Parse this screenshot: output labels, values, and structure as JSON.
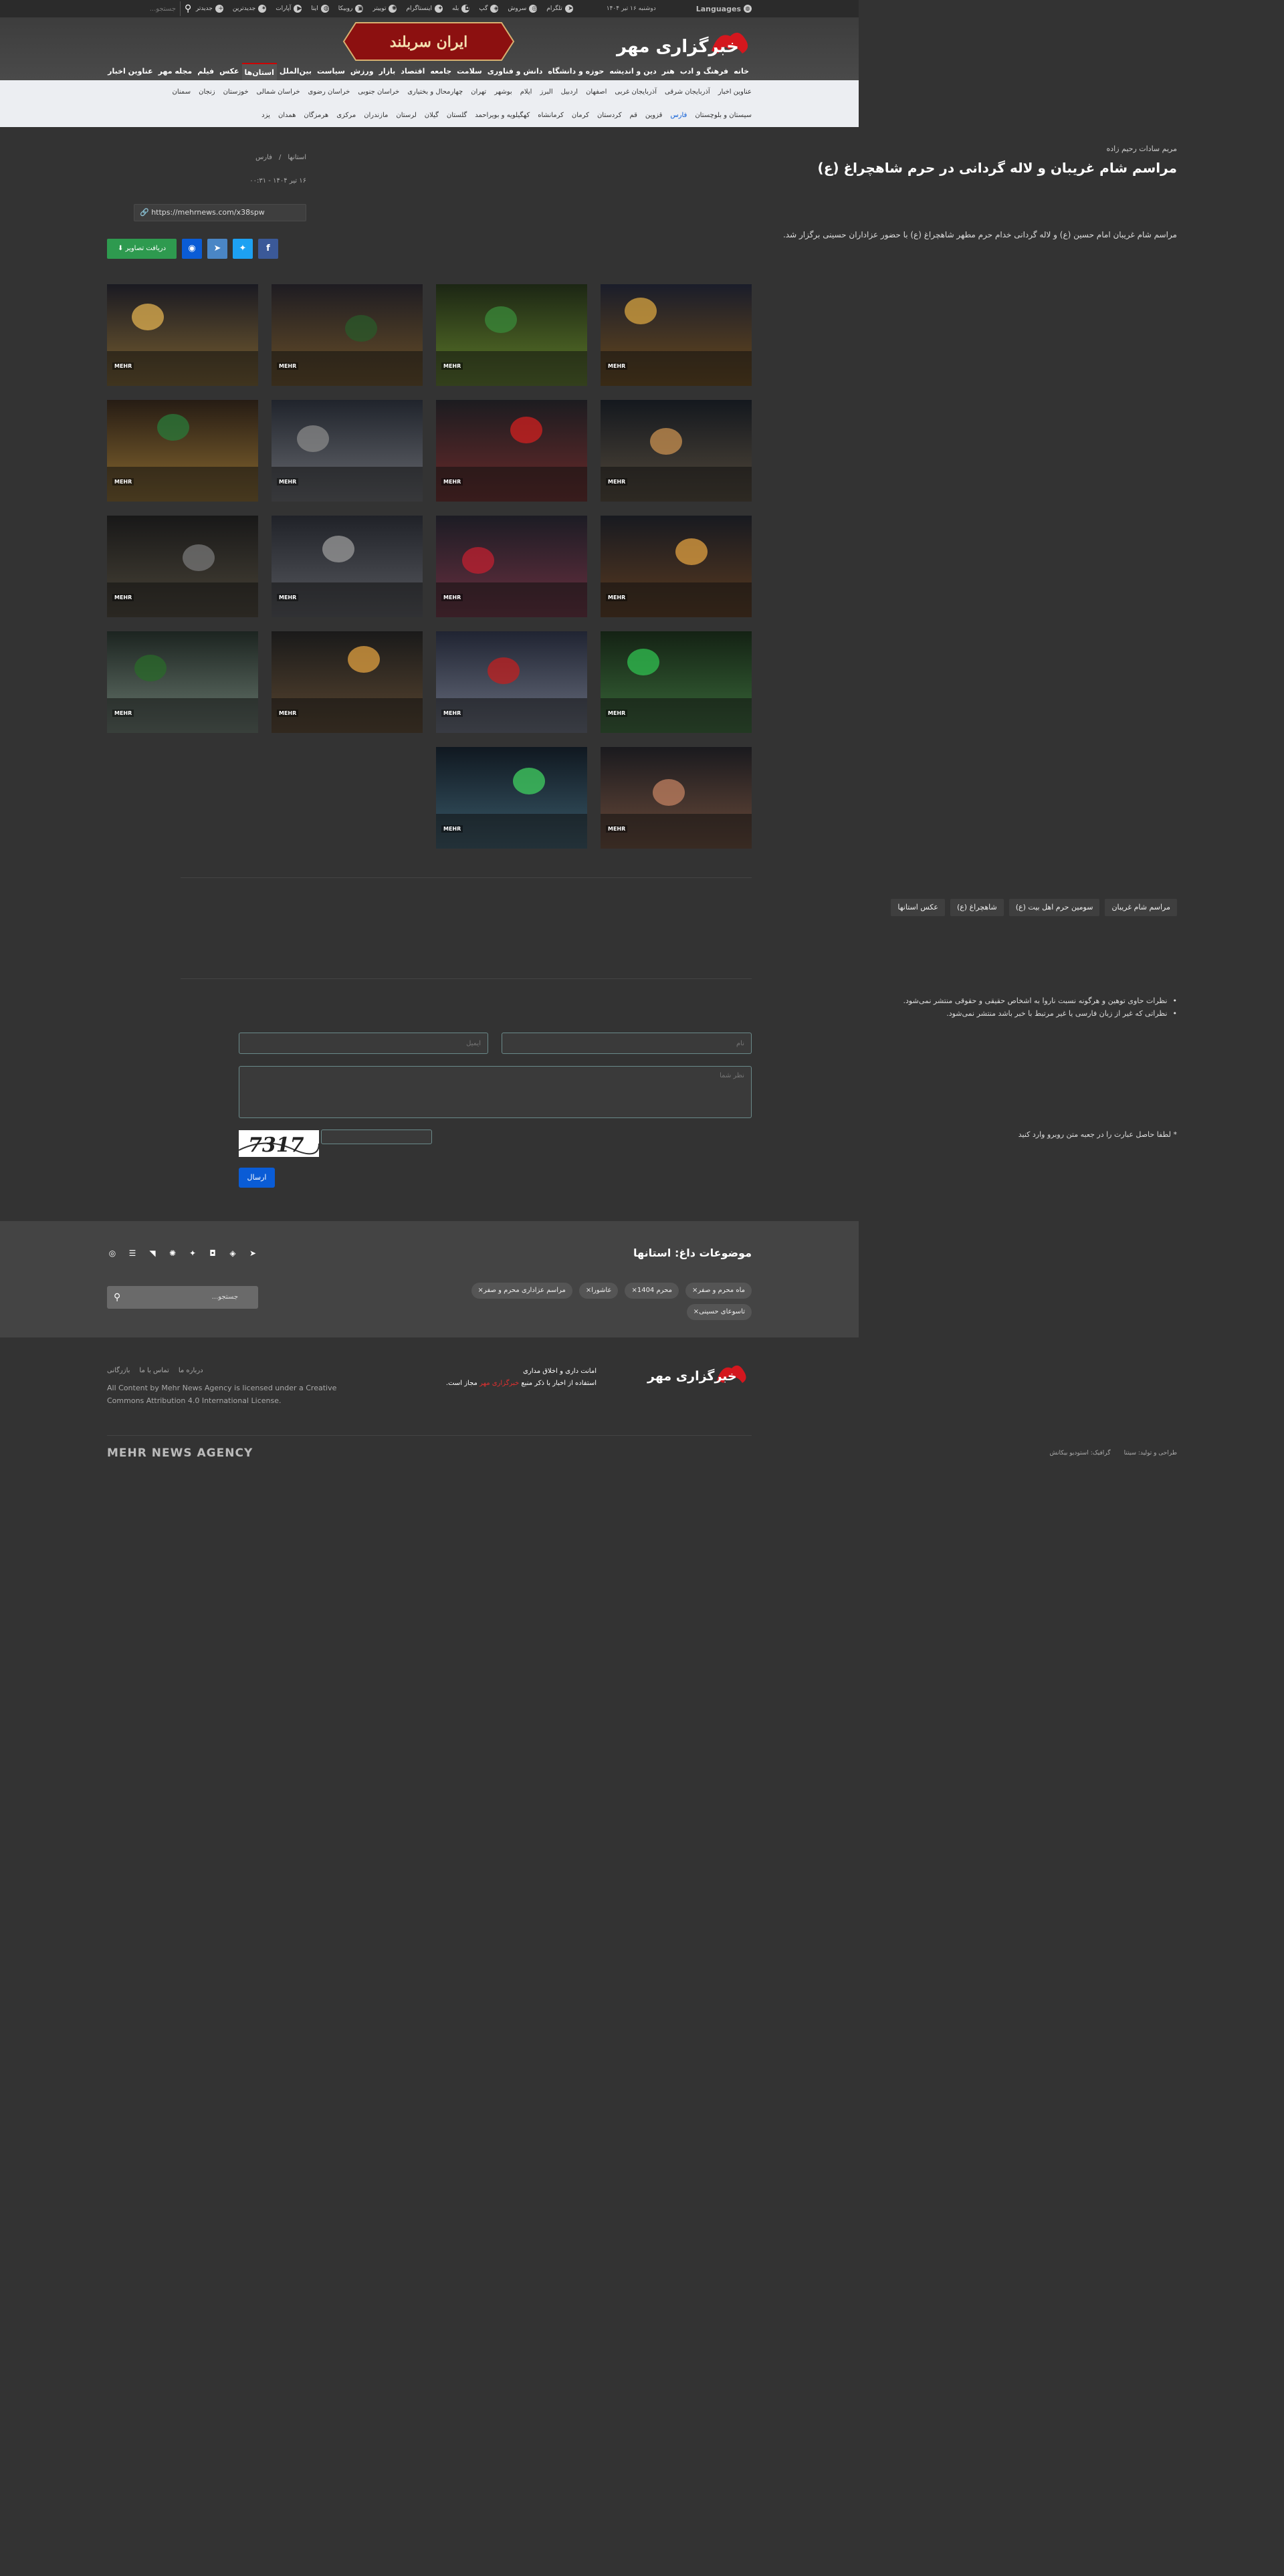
{
  "topbar": {
    "languages": "Languages",
    "date": "دوشنبه ۱۶ تیر ۱۴۰۴",
    "social": [
      "تلگرام",
      "سروش",
      "گپ",
      "بله",
      "اینستاگرام",
      "توییتر",
      "روبیکا",
      "ایتا",
      "آپارات",
      "جدیدترین"
    ],
    "tag_search": "جدیدتر",
    "search_placeholder": "جستجو..."
  },
  "banner_text": "ایران سربلند",
  "logo_text": "خبرگزاری مهر",
  "main_nav": [
    "خانه",
    "فرهنگ و ادب",
    "هنر",
    "دین و اندیشه",
    "حوزه و دانشگاه",
    "دانش و فناوری",
    "سلامت",
    "جامعه",
    "اقتصاد",
    "بازار",
    "ورزش",
    "سیاست",
    "بین‌الملل",
    "استان‌ها",
    "عکس",
    "فیلم",
    "مجله مهر",
    "عناوین اخبار"
  ],
  "main_nav_active": 13,
  "sub_nav_row1": [
    "عناوین اخبار",
    "آذربایجان شرقی",
    "آذربایجان غربی",
    "اصفهان",
    "اردبیل",
    "البرز",
    "ایلام",
    "بوشهر",
    "تهران",
    "چهارمحال و بختیاری",
    "خراسان جنوبی",
    "خراسان رضوی",
    "خراسان شمالی",
    "خوزستان",
    "زنجان",
    "سمنان"
  ],
  "sub_nav_row2": [
    "سیستان و بلوچستان",
    "فارس",
    "قزوین",
    "قم",
    "کردستان",
    "کرمان",
    "کرمانشاه",
    "کهگیلویه و بویراحمد",
    "گلستان",
    "گیلان",
    "لرستان",
    "مازندران",
    "مرکزی",
    "هرمزگان",
    "همدان",
    "یزد"
  ],
  "sub_nav_highlight": 1,
  "article": {
    "author": "مریم سادات رحیم زاده",
    "title": "مراسم شام غریبان و لاله گردانی در حرم شاهچراغ (ع)",
    "breadcrumb": [
      "استانها",
      "فارس"
    ],
    "datetime": "۱۶ تیر ۱۴۰۴ - ۰۰:۳۱",
    "shortlink": "https://mehrnews.com/x38spw",
    "lead": "مراسم شام غریبان امام حسین (ع) و لاله گردانی خدام حرم مطهر شاهچراغ (ع) با حضور عزاداران حسینی برگزار شد.",
    "download_label": "دریافت تصاویر",
    "photo_logo": "MEHR"
  },
  "photos": [
    {
      "c1": "#1a1d2a",
      "c2": "#6b4a1c",
      "accent": "#d8a440"
    },
    {
      "c1": "#1c2614",
      "c2": "#5e7a2a",
      "accent": "#3a8a3a"
    },
    {
      "c1": "#1e1c22",
      "c2": "#6a5028",
      "accent": "#2a5a2a"
    },
    {
      "c1": "#1a1a22",
      "c2": "#7a6030",
      "accent": "#e0b050"
    },
    {
      "c1": "#14181e",
      "c2": "#52483a",
      "accent": "#c89050"
    },
    {
      "c1": "#1c1c20",
      "c2": "#6a2a2a",
      "accent": "#d02020"
    },
    {
      "c1": "#20242c",
      "c2": "#686a70",
      "accent": "#888"
    },
    {
      "c1": "#261c14",
      "c2": "#8a6a30",
      "accent": "#2a7a3a"
    },
    {
      "c1": "#181a20",
      "c2": "#5a3a20",
      "accent": "#e0a040"
    },
    {
      "c1": "#1c1c24",
      "c2": "#6a3040",
      "accent": "#c02030"
    },
    {
      "c1": "#202228",
      "c2": "#585a60",
      "accent": "#999"
    },
    {
      "c1": "#181818",
      "c2": "#4a4438",
      "accent": "#777"
    },
    {
      "c1": "#142214",
      "c2": "#3a6a3a",
      "accent": "#30c050"
    },
    {
      "c1": "#202432",
      "c2": "#6a7080",
      "accent": "#c02020"
    },
    {
      "c1": "#1a1a1a",
      "c2": "#5a4630",
      "accent": "#e0a040"
    },
    {
      "c1": "#1c2420",
      "c2": "#6a7a70",
      "accent": "#2a6a2a"
    },
    {
      "c1": "#1a1a1e",
      "c2": "#6a4a3a",
      "accent": "#c08060"
    },
    {
      "c1": "#101820",
      "c2": "#3a5a6a",
      "accent": "#40d060"
    }
  ],
  "tags": [
    "مراسم شام غریبان",
    "سومین حرم اهل بیت (ع)",
    "شاهچراغ (ع)",
    "عکس استانها"
  ],
  "comments": {
    "rules": [
      "نظرات حاوی توهین و هرگونه نسبت ناروا به اشخاص حقیقی و حقوقی منتشر نمی‌شود.",
      "نظراتی که غیر از زبان فارسی یا غیر مرتبط با خبر باشد منتشر نمی‌شود."
    ],
    "name_placeholder": "نام",
    "email_placeholder": "ایمیل",
    "text_placeholder": "نظر شما",
    "captcha_label": "* لطفا حاصل عبارت را در جعبه متن روبرو وارد کنید",
    "captcha_text": "7317",
    "send_label": "ارسال"
  },
  "hot_tags": {
    "heading": "موضوعات داغ: استانها",
    "row1": [
      "ماه محرم و صفر",
      "محرم 1404",
      "عاشورا",
      "مراسم عزاداری محرم و صفر"
    ],
    "row2": [
      "تاسوعای حسینی"
    ],
    "search_placeholder": "جستجو..."
  },
  "footer": {
    "notice_line1": "امانت داری و اخلاق مداری",
    "notice_line2": "استفاده از اخبار با ذکر منبع",
    "notice_highlight": "خبرگزاری مهر",
    "notice_line2_end": "مجاز است.",
    "links": [
      "درباره ما",
      "تماس با ما",
      "بازرگانی"
    ],
    "license": "All Content by Mehr News Agency is licensed under a Creative Commons Attribution 4.0 International License.",
    "brand": "MEHR NEWS AGENCY",
    "design": [
      "طراحی و تولید: ",
      "سیتنا",
      "گرافیک: استودیو بیکانش"
    ]
  }
}
